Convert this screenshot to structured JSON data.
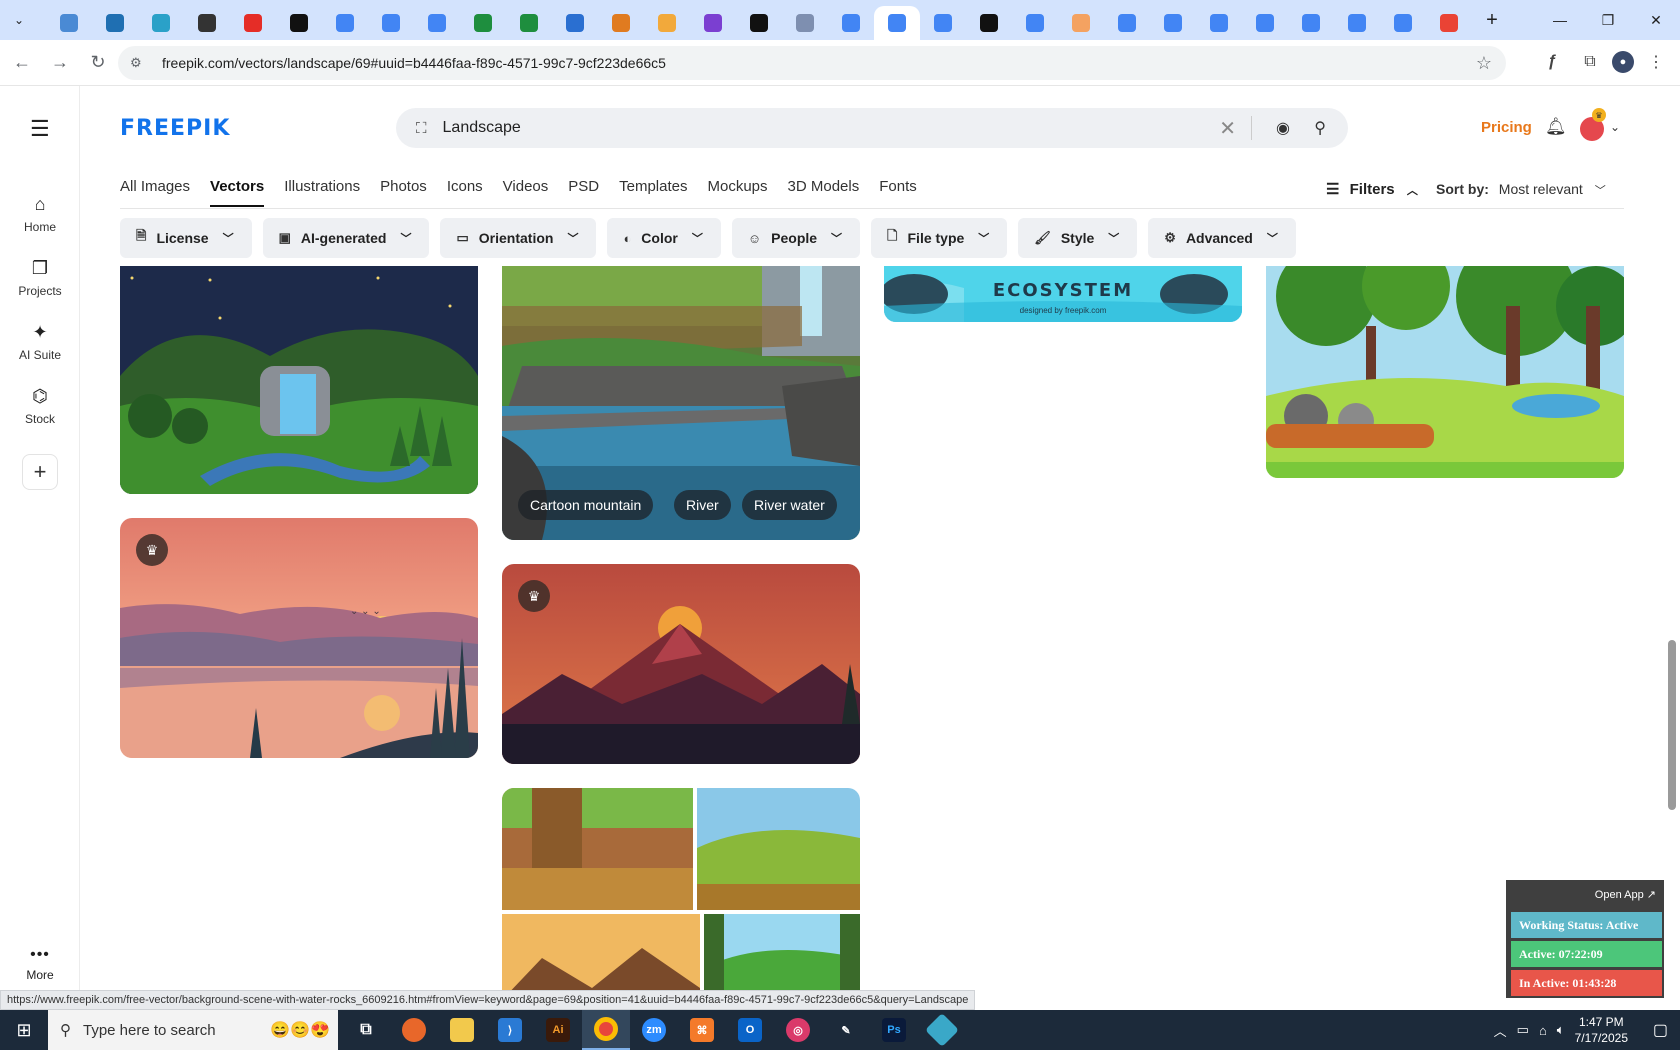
{
  "browser": {
    "url": "freepik.com/vectors/landscape/69#uuid=b4446faa-f89c-4571-99c7-9cf223de66c5",
    "tab_favicon_colors": [
      "#4a8ad4",
      "#1f6fb2",
      "#2aa1c8",
      "#333",
      "#e52d27",
      "#111",
      "#4285f4",
      "#4285f4",
      "#4285f4",
      "#1e8e3e",
      "#1e8e3e",
      "#2a6fd1",
      "#e07b20",
      "#f2a93b",
      "#7b3fd1",
      "#111",
      "#7e8fb0",
      "#4285f4",
      "#4285f4",
      "#4285f4",
      "#111",
      "#4285f4",
      "#f4a261",
      "#4285f4",
      "#4285f4",
      "#4285f4",
      "#4285f4",
      "#4285f4",
      "#4285f4",
      "#4285f4",
      "#ea4335"
    ],
    "active_tab_index": 18
  },
  "sidebar": {
    "items": [
      {
        "label": "Home",
        "icon": "home-icon"
      },
      {
        "label": "Projects",
        "icon": "projects-icon"
      },
      {
        "label": "AI Suite",
        "icon": "sparkle-icon"
      },
      {
        "label": "Stock",
        "icon": "stock-icon"
      }
    ],
    "more_label": "More"
  },
  "header": {
    "logo": "FREEPIK",
    "search_value": "Landscape",
    "pricing": "Pricing"
  },
  "categories": [
    "All Images",
    "Vectors",
    "Illustrations",
    "Photos",
    "Icons",
    "Videos",
    "PSD",
    "Templates",
    "Mockups",
    "3D Models",
    "Fonts"
  ],
  "active_category": "Vectors",
  "toolbar": {
    "filters_label": "Filters",
    "sort_label": "Sort by:",
    "sort_value": "Most relevant"
  },
  "filter_chips": [
    "License",
    "AI-generated",
    "Orientation",
    "Color",
    "People",
    "File type",
    "Style",
    "Advanced"
  ],
  "gallery": {
    "ecosystem_text": "ECOSYSTEM",
    "ecosystem_sub": "designed by freepik.com",
    "tags": [
      "Cartoon mountain",
      "River",
      "River water"
    ]
  },
  "tracker": {
    "open_label": "Open App ↗",
    "status": "Working Status: Active",
    "active": "Active: 07:22:09",
    "inactive": "In Active: 01:43:28",
    "colors": {
      "status": "#5fb8c9",
      "active": "#4cc67a",
      "inactive": "#e8564a"
    }
  },
  "status_url": "https://www.freepik.com/free-vector/background-scene-with-water-rocks_6609216.htm#fromView=keyword&page=69&position=41&uuid=b4446faa-f89c-4571-99c7-9cf223de66c5&query=Landscape",
  "taskbar": {
    "search_placeholder": "Type here to search",
    "time": "1:47 PM",
    "date": "7/17/2025"
  }
}
